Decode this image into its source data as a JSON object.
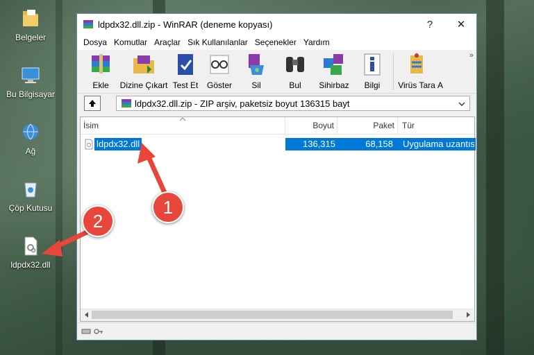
{
  "desktop": {
    "icons": [
      {
        "label": "Belgeler"
      },
      {
        "label": "Bu Bilgisayar"
      },
      {
        "label": "Ağ"
      },
      {
        "label": "Çöp Kutusu"
      },
      {
        "label": "ldpdx32.dll"
      }
    ]
  },
  "window": {
    "title": "ldpdx32.dll.zip - WinRAR (deneme kopyası)",
    "help": "?",
    "close": "✕"
  },
  "menu": [
    "Dosya",
    "Komutlar",
    "Araçlar",
    "Sık Kullanılanlar",
    "Seçenekler",
    "Yardım"
  ],
  "toolbar": {
    "buttons": [
      {
        "label": "Ekle",
        "icon": "books-icon"
      },
      {
        "label": "Dizine Çıkart",
        "icon": "folder-extract-icon"
      },
      {
        "label": "Test Et",
        "icon": "check-book-icon"
      },
      {
        "label": "Göster",
        "icon": "glasses-icon"
      },
      {
        "label": "Sil",
        "icon": "delete-icon"
      },
      {
        "label": "Bul",
        "icon": "binoculars-icon"
      },
      {
        "label": "Sihirbaz",
        "icon": "wizard-icon"
      },
      {
        "label": "Bilgi",
        "icon": "info-icon"
      },
      {
        "label": "Virüs Tara",
        "icon": "virus-scan-icon"
      },
      {
        "label": "A"
      }
    ],
    "overflow": "»"
  },
  "address": {
    "path": "ldpdx32.dll.zip - ZIP arşiv, paketsiz boyut 136315 bayt"
  },
  "columns": [
    "İsim",
    "Boyut",
    "Paket",
    "Tür"
  ],
  "files": [
    {
      "name": "ldpdx32.dll",
      "size": "136,315",
      "packed": "68,158",
      "type": "Uygulama uzantısı"
    }
  ],
  "badges": [
    "1",
    "2"
  ],
  "colors": {
    "selection": "#0078d7",
    "badge": "#e8463a"
  }
}
